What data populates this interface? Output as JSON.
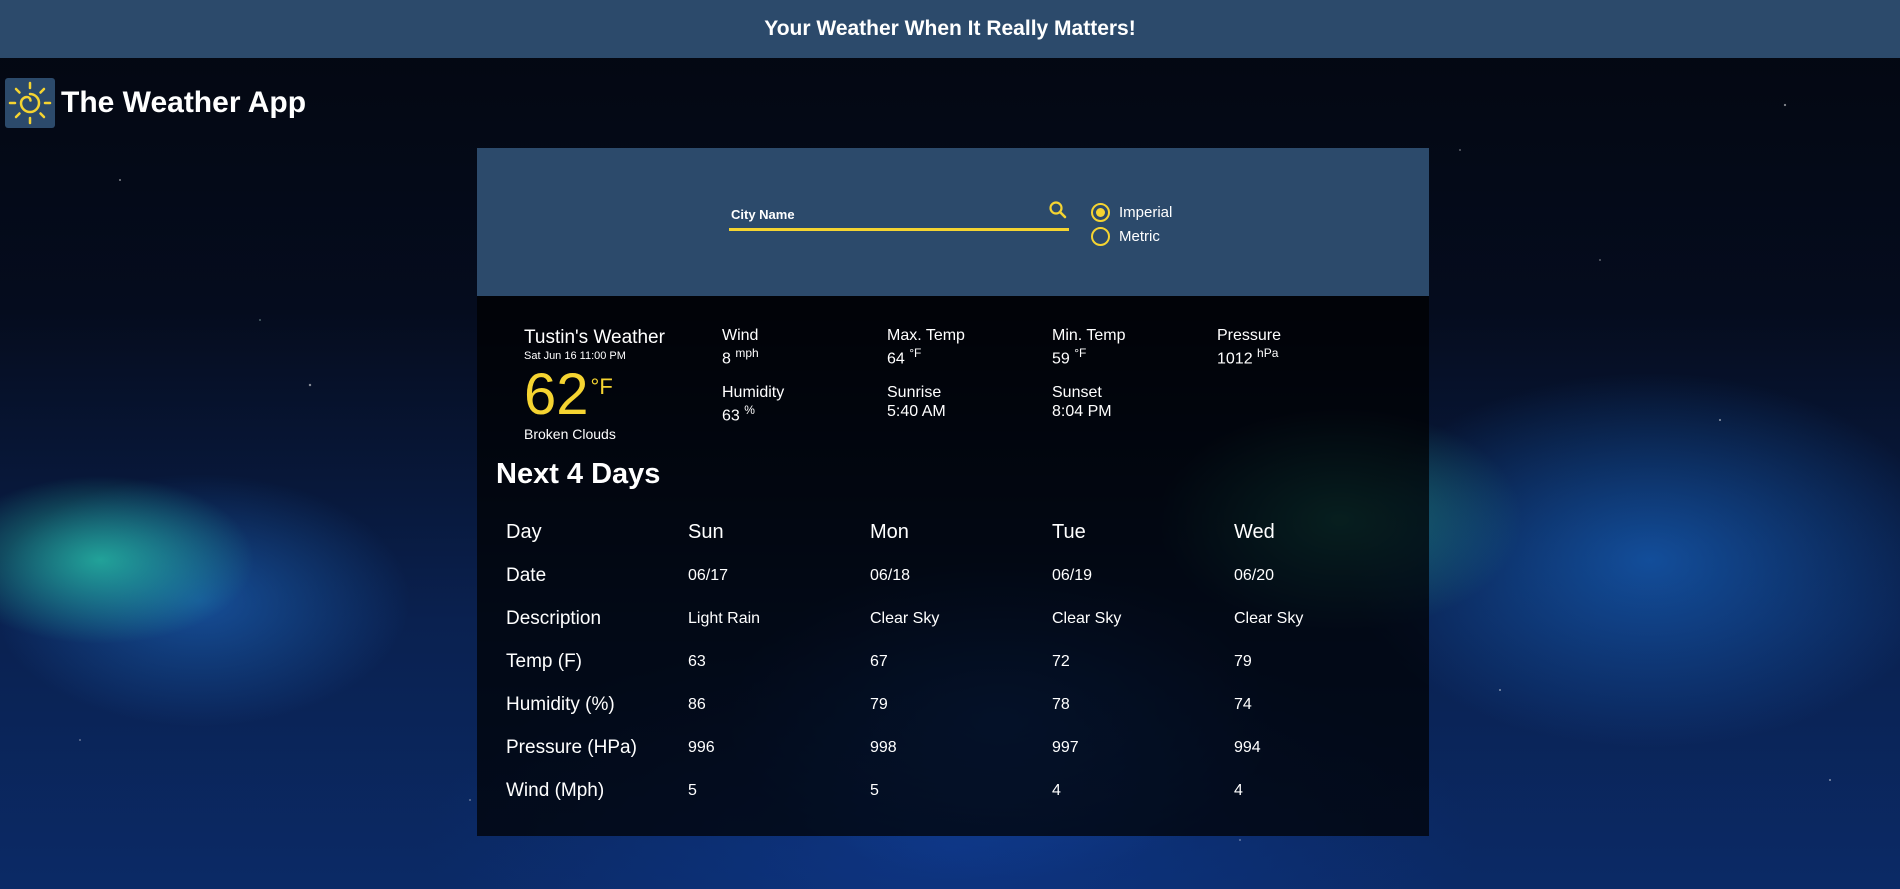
{
  "banner": {
    "text": "Your Weather When It Really Matters!"
  },
  "brand": {
    "title": "The Weather App",
    "logo_icon": "sun-icon"
  },
  "colors": {
    "accent": "#f5d431",
    "panel": "#2c4a6b"
  },
  "search": {
    "placeholder": "City Name",
    "icon": "search-icon"
  },
  "units": {
    "options": [
      {
        "label": "Imperial",
        "selected": true
      },
      {
        "label": "Metric",
        "selected": false
      }
    ]
  },
  "current": {
    "city": "Tustin's Weather",
    "datetime": "Sat Jun 16 11:00 PM",
    "temp": "62",
    "temp_unit": "°F",
    "condition": "Broken Clouds",
    "stats": {
      "wind": {
        "label": "Wind",
        "value": "8",
        "unit": "mph"
      },
      "max_temp": {
        "label": "Max. Temp",
        "value": "64",
        "unit": "°F"
      },
      "min_temp": {
        "label": "Min. Temp",
        "value": "59",
        "unit": "°F"
      },
      "pressure": {
        "label": "Pressure",
        "value": "1012",
        "unit": "hPa"
      },
      "humidity": {
        "label": "Humidity",
        "value": "63",
        "unit": "%"
      },
      "sunrise": {
        "label": "Sunrise",
        "value": "5:40 AM"
      },
      "sunset": {
        "label": "Sunset",
        "value": "8:04 PM"
      }
    }
  },
  "forecast": {
    "title": "Next 4 Days",
    "rows": [
      {
        "header": "Day",
        "values": [
          "Sun",
          "Mon",
          "Tue",
          "Wed"
        ]
      },
      {
        "header": "Date",
        "values": [
          "06/17",
          "06/18",
          "06/19",
          "06/20"
        ]
      },
      {
        "header": "Description",
        "values": [
          "Light Rain",
          "Clear Sky",
          "Clear Sky",
          "Clear Sky"
        ]
      },
      {
        "header": "Temp (F)",
        "values": [
          "63",
          "67",
          "72",
          "79"
        ]
      },
      {
        "header": "Humidity (%)",
        "values": [
          "86",
          "79",
          "78",
          "74"
        ]
      },
      {
        "header": "Pressure (HPa)",
        "values": [
          "996",
          "998",
          "997",
          "994"
        ]
      },
      {
        "header": "Wind (Mph)",
        "values": [
          "5",
          "5",
          "4",
          "4"
        ]
      }
    ]
  }
}
